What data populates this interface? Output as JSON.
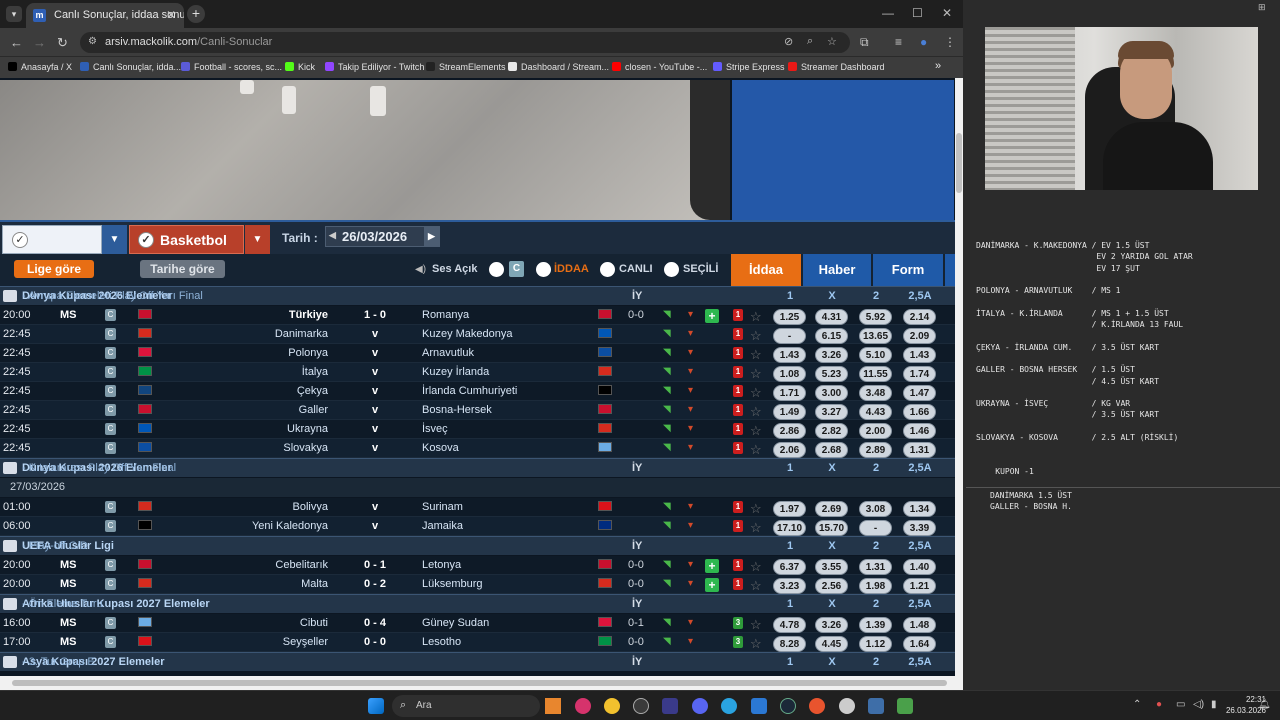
{
  "browser": {
    "tab_title": "Canlı Sonuçlar, iddaa sonuçları",
    "url_domain": "arsiv.mackolik.com",
    "url_path": "/Canli-Sonuclar",
    "bookmarks": [
      {
        "label": "Anasayfa / X",
        "color": "#000000"
      },
      {
        "label": "Canlı Sonuçlar, idda...",
        "color": "#2f5fb4"
      },
      {
        "label": "Football - scores, sc...",
        "color": "#5b5bd6"
      },
      {
        "label": "Kick",
        "color": "#53fc18"
      },
      {
        "label": "Takip Ediliyor - Twitch",
        "color": "#9146ff"
      },
      {
        "label": "StreamElements",
        "color": "#222222"
      },
      {
        "label": "Dashboard / Stream...",
        "color": "#e8e8e8"
      },
      {
        "label": "closen - YouTube -...",
        "color": "#ff0000"
      },
      {
        "label": "Stripe Express",
        "color": "#635bff"
      },
      {
        "label": "Streamer Dashboard",
        "color": "#e91916"
      }
    ]
  },
  "controls": {
    "basketbol": "Basketbol",
    "tarih_label": "Tarih :",
    "date": "26/03/2026",
    "lige_gore": "Lige göre",
    "tarihe_gore": "Tarihe göre",
    "ses_acik": "Ses Açık",
    "c_label": "C",
    "iddaa_filter": "İDDAA",
    "canli_filter": "CANLI",
    "secili_filter": "SEÇİLİ",
    "tabs": [
      "İddaa",
      "Haber",
      "Form"
    ]
  },
  "table": {
    "odds_headers": [
      "1",
      "X",
      "2",
      "2,5A"
    ],
    "iy_label": "İY",
    "c_badge": "C",
    "sections": [
      {
        "league": "Dünya Kupası 2026 Elemeler",
        "stage": "- Avrupa Elemeleri Play Off Yarı Final",
        "matches": [
          {
            "time": "20:00",
            "status": "MS",
            "home": "Türkiye",
            "score": "1 - 0",
            "away": "Romanya",
            "ht": "0-0",
            "plus": true,
            "badge": "1",
            "odds": [
              "1.25",
              "4.31",
              "5.92",
              "2.14"
            ],
            "home_bold": true
          },
          {
            "time": "22:45",
            "status": "",
            "home": "Danimarka",
            "score": "v",
            "away": "Kuzey Makedonya",
            "ht": "",
            "plus": false,
            "badge": "1",
            "odds": [
              "-",
              "6.15",
              "13.65",
              "2.09"
            ]
          },
          {
            "time": "22:45",
            "status": "",
            "home": "Polonya",
            "score": "v",
            "away": "Arnavutluk",
            "ht": "",
            "plus": false,
            "badge": "1",
            "odds": [
              "1.43",
              "3.26",
              "5.10",
              "1.43"
            ]
          },
          {
            "time": "22:45",
            "status": "",
            "home": "İtalya",
            "score": "v",
            "away": "Kuzey İrlanda",
            "ht": "",
            "plus": false,
            "badge": "1",
            "odds": [
              "1.08",
              "5.23",
              "11.55",
              "1.74"
            ]
          },
          {
            "time": "22:45",
            "status": "",
            "home": "Çekya",
            "score": "v",
            "away": "İrlanda Cumhuriyeti",
            "ht": "",
            "plus": false,
            "badge": "1",
            "odds": [
              "1.71",
              "3.00",
              "3.48",
              "1.47"
            ]
          },
          {
            "time": "22:45",
            "status": "",
            "home": "Galler",
            "score": "v",
            "away": "Bosna-Hersek",
            "ht": "",
            "plus": false,
            "badge": "1",
            "odds": [
              "1.49",
              "3.27",
              "4.43",
              "1.66"
            ]
          },
          {
            "time": "22:45",
            "status": "",
            "home": "Ukrayna",
            "score": "v",
            "away": "İsveç",
            "ht": "",
            "plus": false,
            "badge": "1",
            "odds": [
              "2.86",
              "2.82",
              "2.00",
              "1.46"
            ]
          },
          {
            "time": "22:45",
            "status": "",
            "home": "Slovakya",
            "score": "v",
            "away": "Kosova",
            "ht": "",
            "plus": false,
            "badge": "1",
            "odds": [
              "2.06",
              "2.68",
              "2.89",
              "1.31"
            ]
          }
        ]
      },
      {
        "league": "Dünya Kupası 2026 Elemeler",
        "stage": "- Kıtalararası Play Off Yarı Final",
        "date_row": "27/03/2026",
        "matches": [
          {
            "time": "01:00",
            "status": "",
            "home": "Bolivya",
            "score": "v",
            "away": "Surinam",
            "ht": "",
            "plus": false,
            "badge": "1",
            "odds": [
              "1.97",
              "2.69",
              "3.08",
              "1.34"
            ]
          },
          {
            "time": "06:00",
            "status": "",
            "home": "Yeni Kaledonya",
            "score": "v",
            "away": "Jamaika",
            "ht": "",
            "plus": false,
            "badge": "1",
            "odds": [
              "17.10",
              "15.70",
              "-",
              "3.39"
            ]
          }
        ]
      },
      {
        "league": "UEFA Uluslar Ligi",
        "stage": "- Play-off C/D",
        "matches": [
          {
            "time": "20:00",
            "status": "MS",
            "home": "Cebelitarık",
            "score": "0 - 1",
            "away": "Letonya",
            "ht": "0-0",
            "plus": true,
            "badge": "1",
            "odds": [
              "6.37",
              "3.55",
              "1.31",
              "1.40"
            ]
          },
          {
            "time": "20:00",
            "status": "MS",
            "home": "Malta",
            "score": "0 - 2",
            "away": "Lüksemburg",
            "ht": "0-0",
            "plus": true,
            "badge": "1",
            "odds": [
              "3.23",
              "2.56",
              "1.98",
              "1.21"
            ]
          }
        ]
      },
      {
        "league": "Afrika Uluslar Kupası 2027 Elemeler",
        "stage": "- Ön Eleme Turu",
        "matches": [
          {
            "time": "16:00",
            "status": "MS",
            "home": "Cibuti",
            "score": "0 - 4",
            "away": "Güney Sudan",
            "ht": "0-1",
            "plus": false,
            "badge": "3",
            "odds": [
              "4.78",
              "3.26",
              "1.39",
              "1.48"
            ]
          },
          {
            "time": "17:00",
            "status": "MS",
            "home": "Seyşeller",
            "score": "0 - 0",
            "away": "Lesotho",
            "ht": "0-0",
            "plus": false,
            "badge": "3",
            "odds": [
              "8.28",
              "4.45",
              "1.12",
              "1.64"
            ]
          }
        ]
      },
      {
        "league": "Asya Kupası 2027 Elemeler",
        "stage": "- 3. Tur Grup E",
        "matches": []
      }
    ]
  },
  "notes": {
    "lines": [
      "DANİMARKA - K.MAKEDONYA / EV 1.5 ÜST",
      "                         EV 2 YARIDA GOL ATAR",
      "                         EV 17 ŞUT",
      "",
      "POLONYA - ARNAVUTLUK    / MS 1",
      "",
      "İTALYA - K.İRLANDA      / MS 1 + 1.5 ÜST",
      "                        / K.İRLANDA 13 FAUL",
      "",
      "ÇEKYA - İRLANDA CUM.    / 3.5 ÜST KART",
      "",
      "GALLER - BOSNA HERSEK   / 1.5 ÜST",
      "                        / 4.5 ÜST KART",
      "",
      "UKRAYNA - İSVEÇ         / KG VAR",
      "                        / 3.5 ÜST KART",
      "",
      "SLOVAKYA - KOSOVA       / 2.5 ALT (RİSKLİ)",
      "",
      "",
      "    KUPON -1"
    ],
    "kupon_lines": [
      "DANİMARKA 1.5 ÜST",
      "GALLER - BOSNA H."
    ]
  },
  "taskbar": {
    "search": "Ara",
    "time": "22:31",
    "date": "26.03.2026"
  },
  "colors": {
    "accent_orange": "#e86e14",
    "accent_blue": "#2d5c9a",
    "basket_red": "#b8402a"
  }
}
